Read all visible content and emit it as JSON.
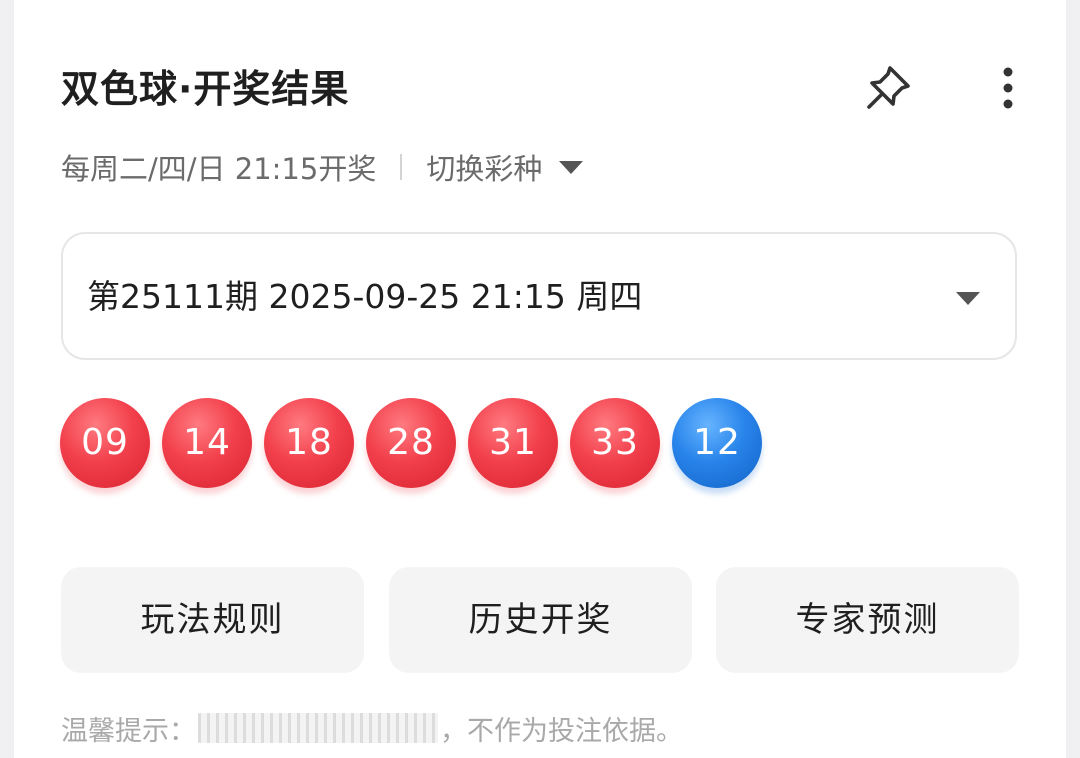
{
  "header": {
    "title": "双色球·开奖结果",
    "pin_icon": "pin-icon",
    "more_icon": "more-vertical-icon"
  },
  "schedule": {
    "text": "每周二/四/日 21:15开奖",
    "switch_label": "切换彩种",
    "switch_icon": "caret-down-icon"
  },
  "issue": {
    "text": "第25111期 2025-09-25 21:15 周四",
    "caret_icon": "caret-down-icon"
  },
  "balls": {
    "red": [
      "09",
      "14",
      "18",
      "28",
      "31",
      "33"
    ],
    "blue": [
      "12"
    ],
    "colors": {
      "red": "#f2404c",
      "blue": "#2884ea"
    }
  },
  "actions": {
    "rules": "玩法规则",
    "history": "历史开奖",
    "expert": "专家预测"
  },
  "tip": {
    "prefix": "温馨提示：",
    "suffix": "，不作为投注依据。"
  }
}
